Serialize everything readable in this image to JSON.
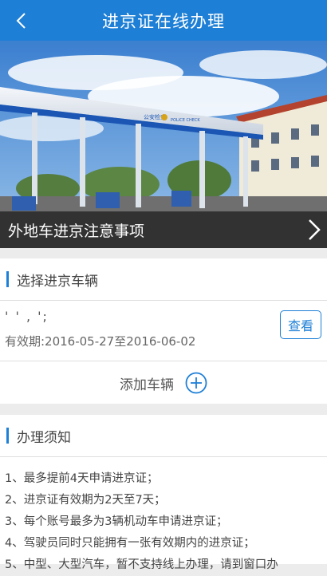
{
  "header": {
    "title": "进京证在线办理"
  },
  "banner": {
    "caption": "外地车进京注意事项",
    "sign_text": "公安检查",
    "sign_text_en": "POLICE CHECK"
  },
  "vehicle_section": {
    "heading": "选择进京车辆",
    "vehicle": {
      "plate": "' '  ,  ';",
      "validity": "有效期:2016-05-27至2016-06-02",
      "view_label": "查看"
    },
    "add_label": "添加车辆"
  },
  "notice_section": {
    "heading": "办理须知",
    "rules": [
      "1、最多提前4天申请进京证；",
      "2、进京证有效期为2天至7天；",
      "3、每个账号最多为3辆机动车申请进京证；",
      "4、驾驶员同时只能拥有一张有效期内的进京证；",
      "5、中型、大型汽车，暂不支持线上办理，请到窗口办"
    ]
  },
  "colors": {
    "brand": "#1e7fd6",
    "background": "#ececec"
  }
}
